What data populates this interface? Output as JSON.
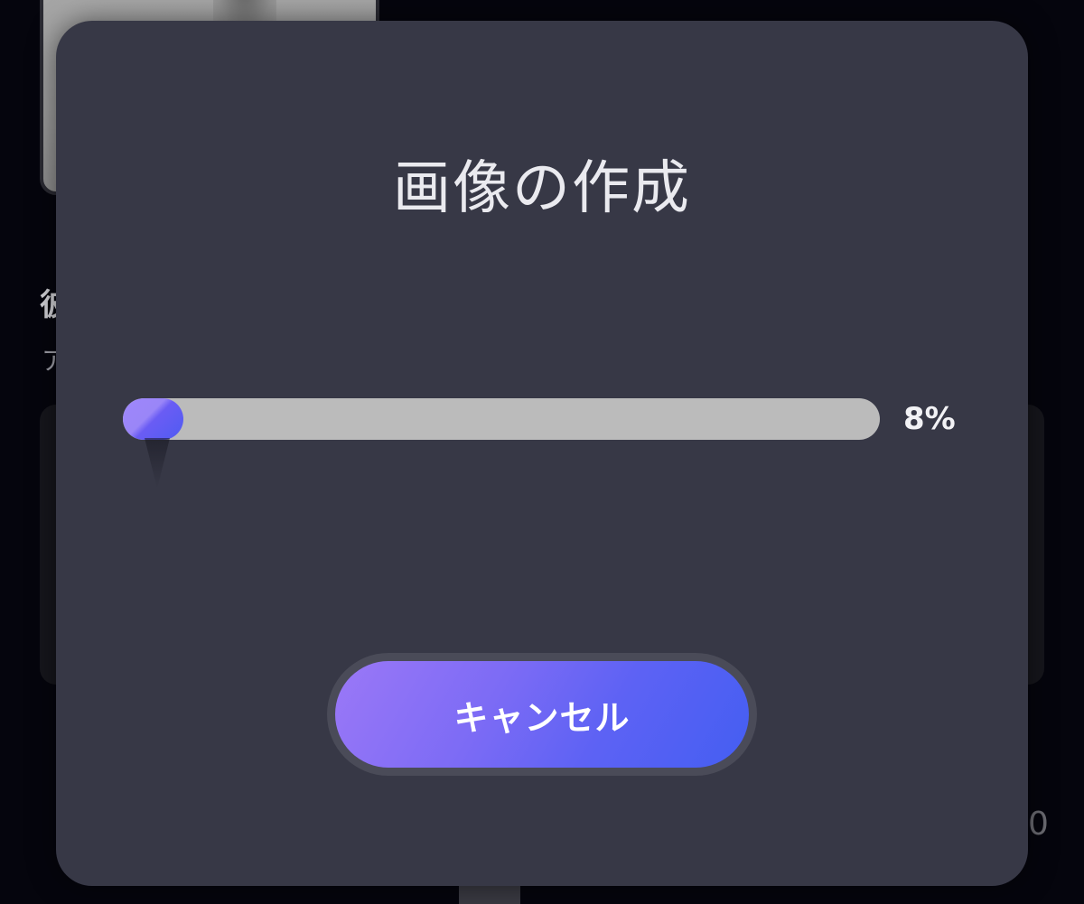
{
  "background": {
    "title_fragment": "彼",
    "subtitle_fragment": "ア",
    "count_fragment": "0"
  },
  "dialog": {
    "title": "画像の作成",
    "progress": {
      "value": 8,
      "label": "8%"
    },
    "cancel_label": "キャンセル"
  },
  "colors": {
    "modal_bg": "#373846",
    "track": "#bbbbbb",
    "accent_start": "#9b78f7",
    "accent_end": "#445ef2"
  }
}
